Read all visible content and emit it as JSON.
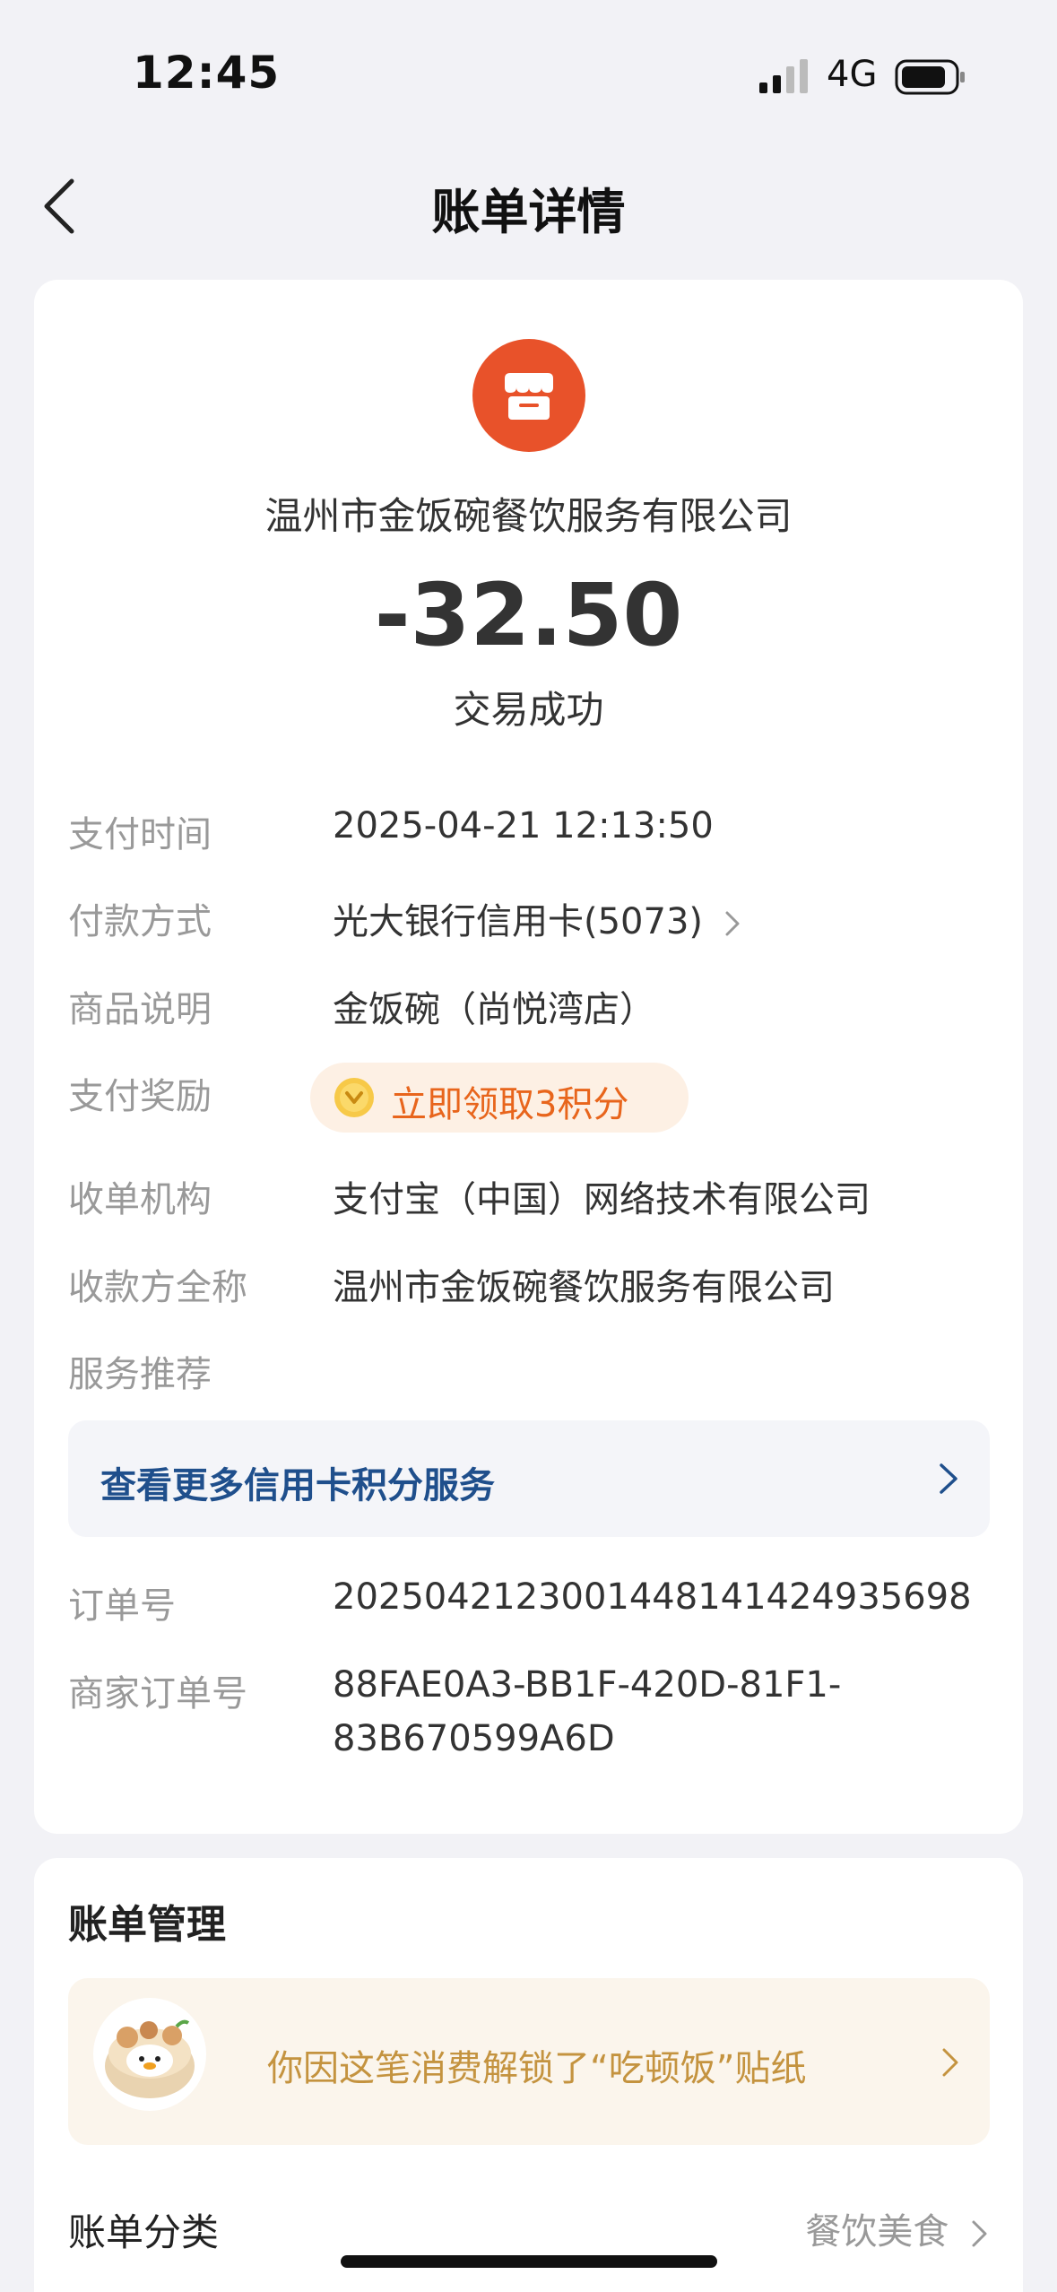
{
  "status_bar": {
    "time": "12:45",
    "network": "4G"
  },
  "nav": {
    "title": "账单详情"
  },
  "transaction": {
    "merchant_icon": "store-icon",
    "merchant_name": "温州市金饭碗餐饮服务有限公司",
    "amount": "-32.50",
    "status": "交易成功"
  },
  "details": [
    {
      "label": "支付时间",
      "value": "2025-04-21 12:13:50"
    },
    {
      "label": "付款方式",
      "value": "光大银行信用卡(5073)"
    },
    {
      "label": "商品说明",
      "value": "金饭碗（尚悦湾店）"
    },
    {
      "label": "支付奖励",
      "value": "立即领取3积分"
    },
    {
      "label": "收单机构",
      "value": "支付宝（中国）网络技术有限公司"
    },
    {
      "label": "收款方全称",
      "value": "温州市金饭碗餐饮服务有限公司"
    },
    {
      "label": "服务推荐",
      "value": ""
    }
  ],
  "promo": {
    "text": "查看更多信用卡积分服务"
  },
  "order": {
    "order_no_label": "订单号",
    "order_no": "2025042123001448141424935698",
    "merchant_order_label": "商家订单号",
    "merchant_order_line1": "88FAE0A3-BB1F-420D-81F1-",
    "merchant_order_line2": "83B670599A6D"
  },
  "bill_management": {
    "title": "账单管理",
    "sticker_text": "你因这笔消费解锁了“吃顿饭”贴纸",
    "category_label": "账单分类",
    "category_value": "餐饮美食"
  },
  "colors": {
    "accent_orange": "#e8522a",
    "reward_orange": "#e8651c",
    "promo_blue": "#1f4f8c",
    "sticker_gold": "#c4933f"
  }
}
